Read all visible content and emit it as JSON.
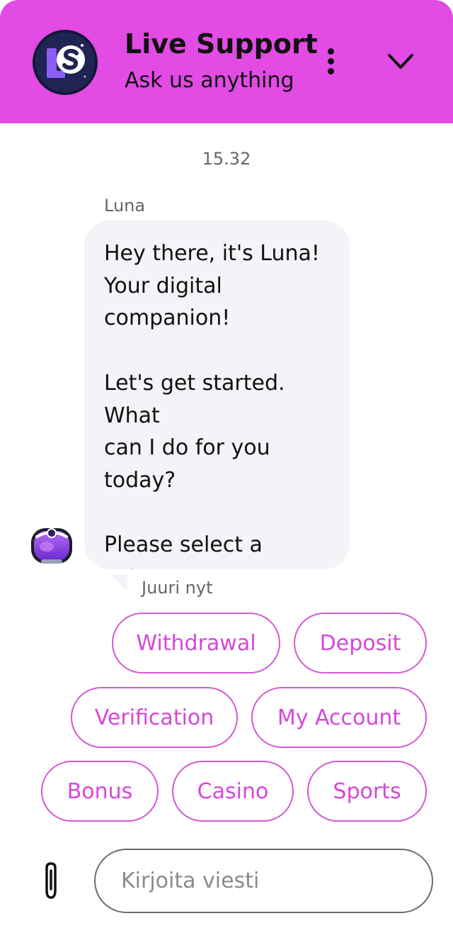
{
  "header": {
    "title": "Live Support",
    "subtitle": "Ask us anything",
    "brand_color": "#e24be4",
    "logo_icon": "ls-logo",
    "menu_icon": "more-vertical-icon",
    "collapse_icon": "chevron-down-icon"
  },
  "conversation": {
    "timestamp": "15.32",
    "message": {
      "sender": "Luna",
      "text": "Hey there, it's Luna!\nYour digital\ncompanion!\n\nLet's get started. What\ncan I do for you\ntoday?\n\nPlease select a\ncategory:",
      "time": "Juuri nyt",
      "avatar_icon": "robot-avatar-icon"
    },
    "options": [
      {
        "label": "Withdrawal"
      },
      {
        "label": "Deposit"
      },
      {
        "label": "Verification"
      },
      {
        "label": "My Account"
      },
      {
        "label": "Bonus"
      },
      {
        "label": "Casino"
      },
      {
        "label": "Sports"
      }
    ],
    "option_color": "#d548d8"
  },
  "composer": {
    "placeholder": "Kirjoita viesti",
    "value": "",
    "attach_icon": "paperclip-icon"
  }
}
